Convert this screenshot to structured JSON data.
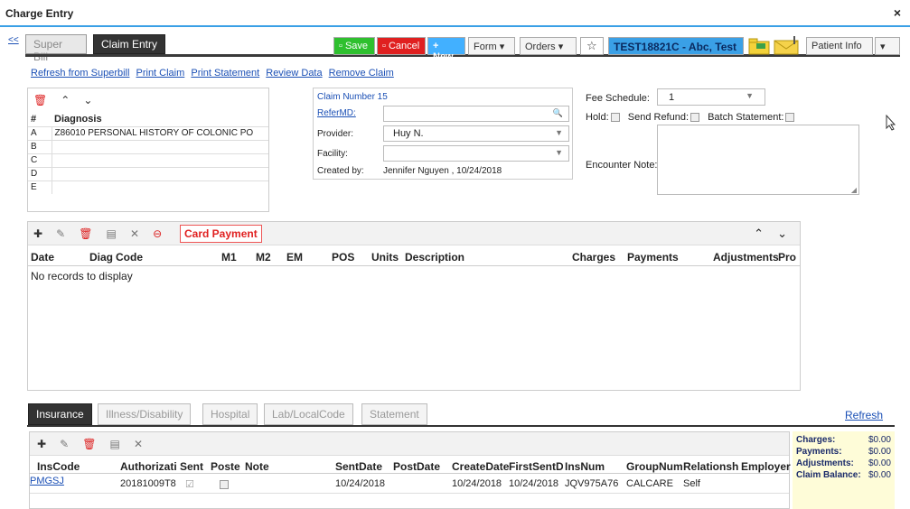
{
  "window": {
    "title": "Charge Entry",
    "close": "×"
  },
  "toolbar": {
    "collapse": "<<",
    "tab_super": "Super Bill",
    "tab_claim": "Claim Entry",
    "save": "Save",
    "cancel": "Cancel",
    "new": "New",
    "form": "Form",
    "orders": "Orders",
    "patient": "TEST18821C - Abc, Test",
    "patient_info": "Patient Info"
  },
  "links": [
    "Refresh from Superbill",
    "Print Claim",
    "Print Statement",
    "Review Data",
    "Remove Claim"
  ],
  "diagnosis": {
    "col_num": "#",
    "col_dx": "Diagnosis",
    "rows": [
      {
        "n": "A",
        "dx": "Z86010 PERSONAL HISTORY OF COLONIC PO"
      },
      {
        "n": "B",
        "dx": ""
      },
      {
        "n": "C",
        "dx": ""
      },
      {
        "n": "D",
        "dx": ""
      },
      {
        "n": "E",
        "dx": ""
      }
    ]
  },
  "claim": {
    "number": "Claim Number 15",
    "refer_label": "ReferMD:",
    "refer_value": "",
    "provider_label": "Provider:",
    "provider_value": "Huy N.",
    "facility_label": "Facility:",
    "facility_value": "",
    "created_label": "Created by:",
    "created_value": "Jennifer Nguyen , 10/24/2018"
  },
  "fee": {
    "label": "Fee Schedule:",
    "value": "1",
    "hold": "Hold:",
    "send_refund": "Send Refund:",
    "batch": "Batch Statement:",
    "encounter": "Encounter Note:"
  },
  "charges": {
    "card_payment": "Card Payment",
    "columns": [
      "Date",
      "Diag",
      "Code",
      "M1",
      "M2",
      "EM",
      "POS",
      "Units",
      "Description",
      "Charges",
      "Payments",
      "Adjustments",
      "Pro"
    ],
    "empty": "No records to display"
  },
  "bottom_tabs": [
    "Insurance",
    "Illness/Disability",
    "Hospital",
    "Lab/LocalCode",
    "Statement"
  ],
  "refresh": "Refresh",
  "insurance": {
    "columns": [
      "InsCode",
      "Authorizati",
      "Sent",
      "Poste",
      "Note",
      "SentDate",
      "PostDate",
      "CreateDate",
      "FirstSentDa",
      "InsNum",
      "GroupNum",
      "Relationshi",
      "Employer"
    ],
    "row": [
      "PMGSJ",
      "20181009T8",
      "",
      "",
      "",
      "10/24/2018",
      "",
      "10/24/2018",
      "10/24/2018",
      "JQV975A76",
      "CALCARE",
      "Self",
      ""
    ]
  },
  "totals": {
    "charges_label": "Charges:",
    "charges": "$0.00",
    "payments_label": "Payments:",
    "payments": "$0.00",
    "adjustments_label": "Adjustments:",
    "adjustments": "$0.00",
    "balance_label": "Claim Balance:",
    "balance": "$0.00"
  }
}
